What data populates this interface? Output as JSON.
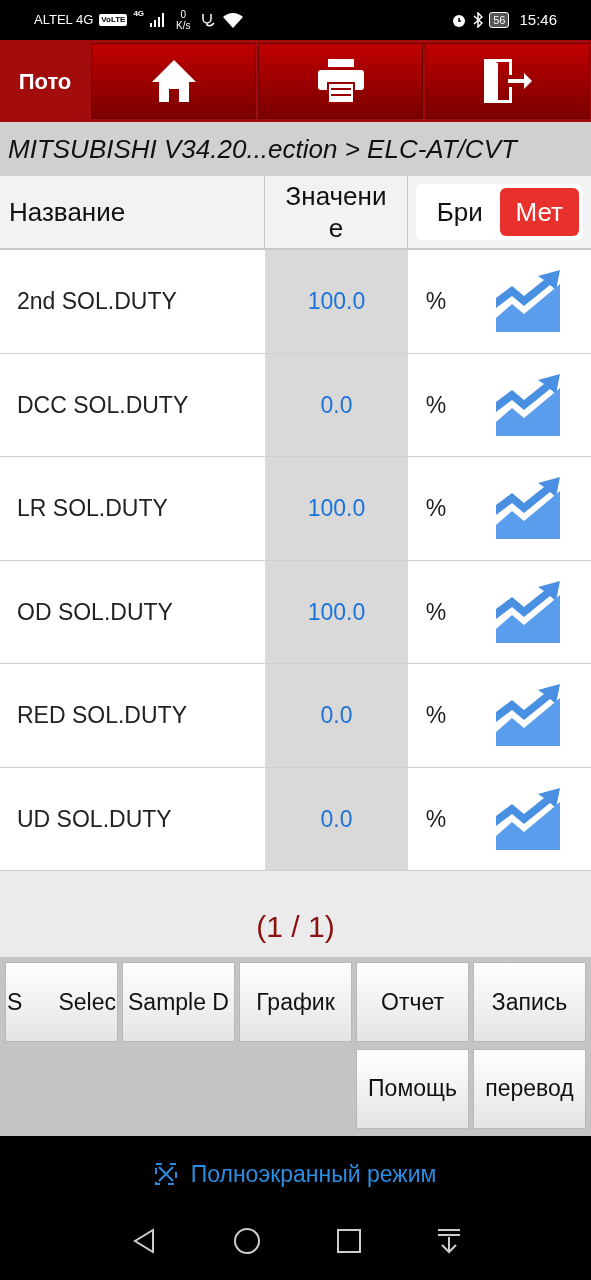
{
  "status_bar": {
    "carrier": "ALTEL 4G",
    "volte": "VoLTE",
    "net": "4G",
    "speed_value": "0",
    "speed_unit": "K/s",
    "battery": "56",
    "time": "15:46"
  },
  "toolbar": {
    "title": "Пото",
    "buttons": [
      {
        "kind": "home"
      },
      {
        "kind": "print"
      },
      {
        "kind": "exit"
      }
    ]
  },
  "breadcrumb": "MITSUBISHI V34.20...ection > ELC-AT/CVT",
  "table": {
    "columns": [
      "Название",
      "Значение"
    ],
    "unit_toggle": [
      {
        "label": "Бри",
        "selected": false
      },
      {
        "label": "Мет",
        "selected": true
      }
    ],
    "rows": [
      {
        "name": "2nd SOL.DUTY",
        "value": "100.0",
        "unit": "%"
      },
      {
        "name": "DCC SOL.DUTY",
        "value": "0.0",
        "unit": "%"
      },
      {
        "name": "LR SOL.DUTY",
        "value": "100.0",
        "unit": "%"
      },
      {
        "name": "OD SOL.DUTY",
        "value": "100.0",
        "unit": "%"
      },
      {
        "name": "RED SOL.DUTY",
        "value": "0.0",
        "unit": "%"
      },
      {
        "name": "UD SOL.DUTY",
        "value": "0.0",
        "unit": "%"
      }
    ]
  },
  "pagination": "(1 / 1)",
  "actions": [
    {
      "parts": [
        "S",
        "Selec"
      ]
    },
    {
      "parts": [
        "Sample D"
      ]
    },
    {
      "parts": [
        "График"
      ]
    },
    {
      "parts": [
        "Отчет"
      ]
    },
    {
      "parts": [
        "Запись"
      ]
    },
    {
      "parts": [
        "Помощь"
      ]
    },
    {
      "parts": [
        "перевод"
      ]
    }
  ],
  "fullscreen": "Полноэкранный режим"
}
